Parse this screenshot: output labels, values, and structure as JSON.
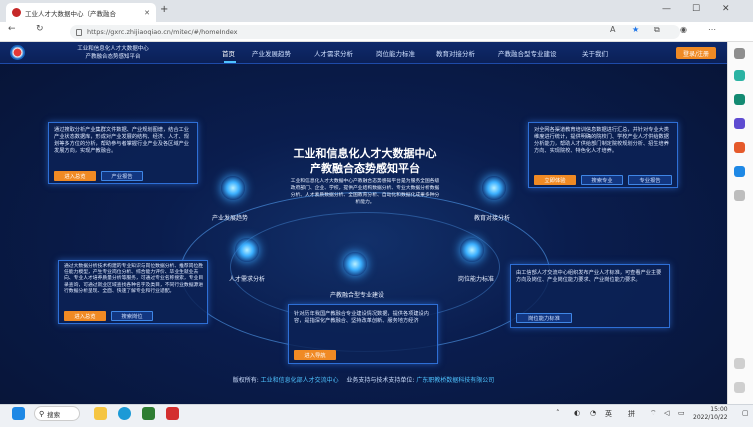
{
  "browser": {
    "tab_title": "工业人才大数据中心（产教融合",
    "new_tab": "+",
    "url": "https://gxrc.zhijiaoqiao.cn/mitec/#/homeIndex",
    "min": "—",
    "max": "☐",
    "close": "✕"
  },
  "site": {
    "name_line1": "工业和信息化人才大数据中心",
    "name_line2": "产教融合态势感知平台",
    "nav": [
      "首页",
      "产业发展趋势",
      "人才需求分析",
      "岗位能力标准",
      "教育对接分析",
      "产教融合型专业建设",
      "关于我们"
    ],
    "login": "登录/注册"
  },
  "center": {
    "title_line1": "工业和信息化人才大数据中心",
    "title_line2": "产教融合态势感知平台",
    "desc": "工业和信息化人才大数据中心产教融合态势感知平台是为服务全国各级政府部门、企业、学校，提供产业结构数据分析、专业大数据分析数据分析、人才素质数据分析、全国教育分析、自动化和数据化成果多种分析能力。"
  },
  "nodes": {
    "industry": "产业发展趋势",
    "talent": "人才需求分析",
    "merge": "产教融合型专业建设",
    "ability": "岗位能力标准",
    "education": "教育对接分析"
  },
  "panels": {
    "topleft": {
      "text": "通过搜取分析产业集群文件数据、产业规划图谱，结合工业产业状态数据库，形成对产业发展的结构、经济、人才、规划等多方位的分析，帮助参与者掌握行业产业及各区域产业发展方向，实现产教融合。",
      "btn1": "进入总览",
      "btn2": "产业报告"
    },
    "topright": {
      "text": "对全网各渠道教育培训信息数据进行汇总，并针对专业大类维度进行统计，提供明确的院校门、学校产业人才供给数据分析能力，帮助人才供给部门制定院校规划分析、招生培养方向、实现院校、特色化人才培养。",
      "btn1": "立即体验",
      "btn2": "搜索专业",
      "btn3": "专业报告"
    },
    "midleft": {
      "text": "通过大数据分析技术构建的专业知识与岗位数据分析、推荐岗位胜任能力模型，产生专业岗位分析、综合能力评价、毕业生就业去向、专业人才培养质量分析等服务，可通过专业名称搜索，专业目录查询，可通过就业区域查找各种名字及类目，不同行业数据源进行数据分析呈现、全面、快速了解专业和行业适配。",
      "btn1": "进入总览",
      "btn2": "搜索岗位"
    },
    "midright": {
      "text": "由工信部人才交流中心组织发布产业人才标准，可查看产业主要方向及岗位、产业岗位能力要求、产业岗位能力要求。",
      "btn1": "岗位能力标准"
    },
    "bottom": {
      "text": "针对历年我国产教融合专业建设情况数据，提供各项建设内容，是指深化产教融合、坚持改革创新、服务地方经济",
      "btn1": "进入导航"
    }
  },
  "footer": {
    "copyright_label": "版权所有:",
    "copyright": "工业和信息化部人才交流中心",
    "support_label": "业务支持与技术支持单位:",
    "support": "广东职教桥数据科技有限公司"
  },
  "taskbar": {
    "search": "搜索",
    "lang1": "英",
    "lang2": "拼",
    "time": "15:00",
    "date": "2022/10/22"
  },
  "colors": {
    "accent": "#f08a24",
    "page_bg": "#0a1d4e",
    "highlight": "#4fc3ff"
  }
}
